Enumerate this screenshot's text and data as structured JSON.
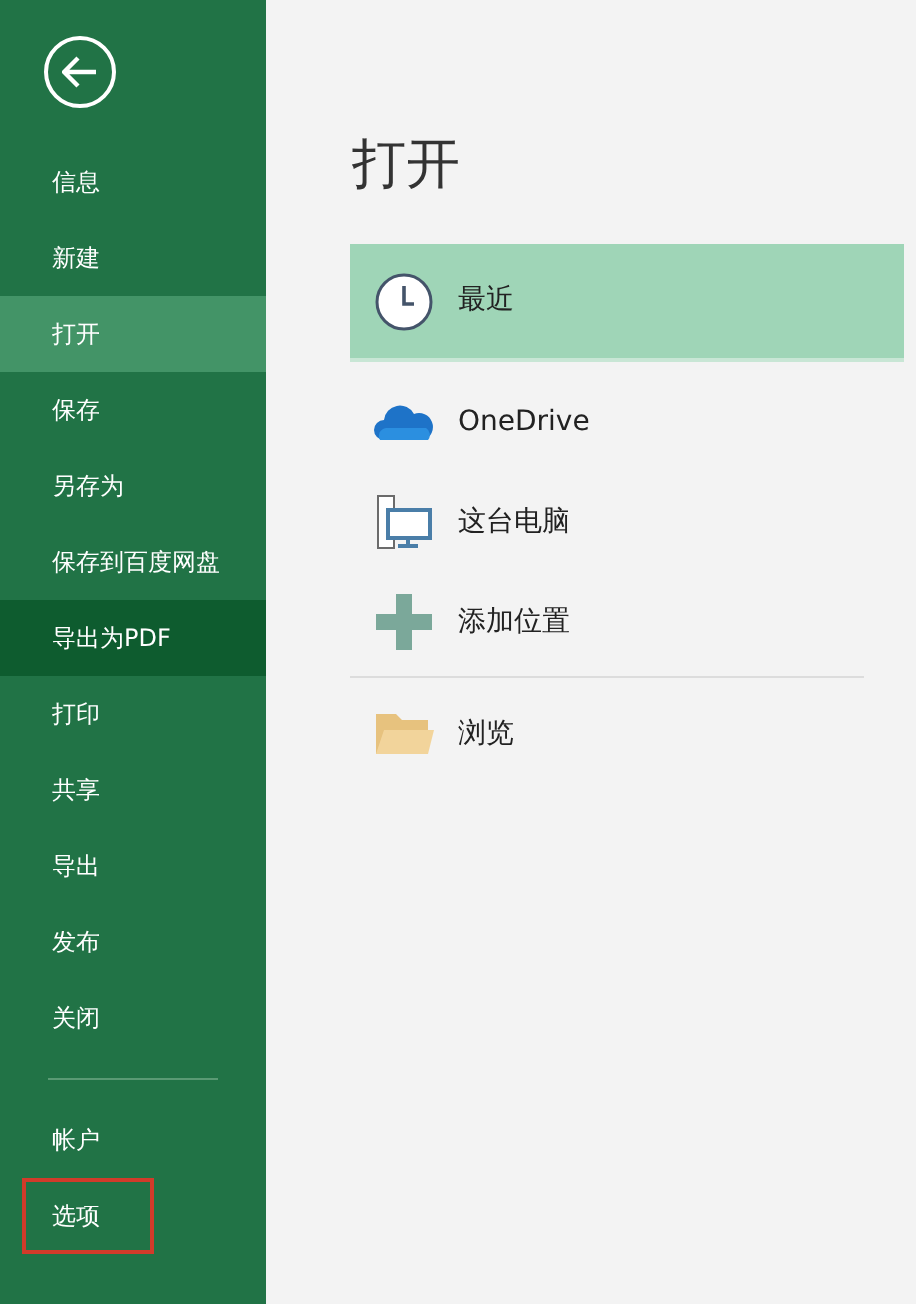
{
  "sidebar": {
    "items": [
      {
        "label": "信息",
        "selected": false,
        "hovered": false,
        "outlined": false,
        "divider_before": false
      },
      {
        "label": "新建",
        "selected": false,
        "hovered": false,
        "outlined": false,
        "divider_before": false
      },
      {
        "label": "打开",
        "selected": true,
        "hovered": false,
        "outlined": false,
        "divider_before": false
      },
      {
        "label": "保存",
        "selected": false,
        "hovered": false,
        "outlined": false,
        "divider_before": false
      },
      {
        "label": "另存为",
        "selected": false,
        "hovered": false,
        "outlined": false,
        "divider_before": false
      },
      {
        "label": "保存到百度网盘",
        "selected": false,
        "hovered": false,
        "outlined": false,
        "divider_before": false
      },
      {
        "label": "导出为PDF",
        "selected": false,
        "hovered": true,
        "outlined": false,
        "divider_before": false
      },
      {
        "label": "打印",
        "selected": false,
        "hovered": false,
        "outlined": false,
        "divider_before": false
      },
      {
        "label": "共享",
        "selected": false,
        "hovered": false,
        "outlined": false,
        "divider_before": false
      },
      {
        "label": "导出",
        "selected": false,
        "hovered": false,
        "outlined": false,
        "divider_before": false
      },
      {
        "label": "发布",
        "selected": false,
        "hovered": false,
        "outlined": false,
        "divider_before": false
      },
      {
        "label": "关闭",
        "selected": false,
        "hovered": false,
        "outlined": false,
        "divider_before": false
      },
      {
        "label": "帐户",
        "selected": false,
        "hovered": false,
        "outlined": false,
        "divider_before": true
      },
      {
        "label": "选项",
        "selected": false,
        "hovered": false,
        "outlined": true,
        "divider_before": false
      }
    ]
  },
  "main": {
    "title": "打开",
    "locations": [
      {
        "kind": "clock",
        "label": "最近",
        "selected": true,
        "divider_before": false
      },
      {
        "kind": "cloud",
        "label": "OneDrive",
        "selected": false,
        "divider_before": false
      },
      {
        "kind": "computer",
        "label": "这台电脑",
        "selected": false,
        "divider_before": false
      },
      {
        "kind": "plus",
        "label": "添加位置",
        "selected": false,
        "divider_before": false
      },
      {
        "kind": "folder",
        "label": "浏览",
        "selected": false,
        "divider_before": true
      }
    ]
  }
}
